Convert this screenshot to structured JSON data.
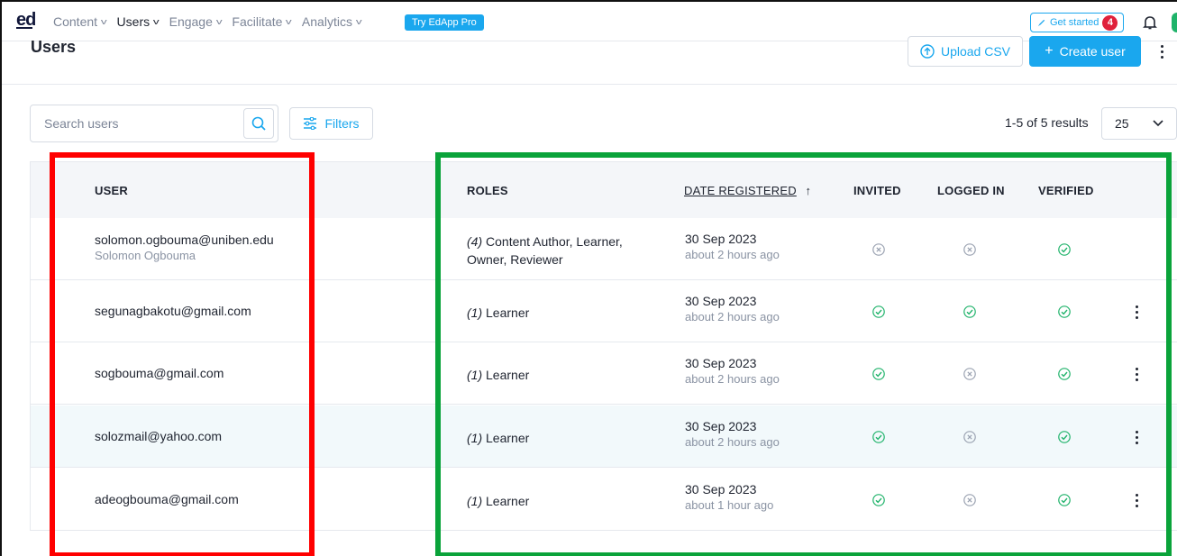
{
  "nav": {
    "logo": "ed",
    "items": [
      "Content",
      "Users",
      "Engage",
      "Facilitate",
      "Analytics"
    ],
    "active": "Users",
    "try_pro": "Try EdApp Pro",
    "get_started": "Get started",
    "get_started_count": "4"
  },
  "header": {
    "title": "Users",
    "upload_label": "Upload CSV",
    "create_label": "Create user"
  },
  "toolbar": {
    "search_placeholder": "Search users",
    "filters_label": "Filters",
    "results_text": "1-5 of 5 results",
    "page_size": "25"
  },
  "table": {
    "columns": {
      "user": "USER",
      "roles": "ROLES",
      "date": "DATE REGISTERED",
      "invited": "INVITED",
      "logged_in": "LOGGED IN",
      "verified": "VERIFIED"
    },
    "sort_indicator": "↑",
    "rows": [
      {
        "email": "solomon.ogbouma@uniben.edu",
        "name": "Solomon Ogbouma",
        "role_count": "(4)",
        "roles_line1": "Content Author, Learner,",
        "roles_line2": "Owner, Reviewer",
        "date": "30 Sep 2023",
        "relative": "about 2 hours ago",
        "invited": false,
        "logged_in": false,
        "verified": true,
        "has_menu": false
      },
      {
        "email": "segunagbakotu@gmail.com",
        "name": "",
        "role_count": "(1)",
        "roles_line1": "Learner",
        "roles_line2": "",
        "date": "30 Sep 2023",
        "relative": "about 2 hours ago",
        "invited": true,
        "logged_in": true,
        "verified": true,
        "has_menu": true
      },
      {
        "email": "sogbouma@gmail.com",
        "name": "",
        "role_count": "(1)",
        "roles_line1": "Learner",
        "roles_line2": "",
        "date": "30 Sep 2023",
        "relative": "about 2 hours ago",
        "invited": true,
        "logged_in": false,
        "verified": true,
        "has_menu": true
      },
      {
        "email": "solozmail@yahoo.com",
        "name": "",
        "role_count": "(1)",
        "roles_line1": "Learner",
        "roles_line2": "",
        "date": "30 Sep 2023",
        "relative": "about 2 hours ago",
        "invited": true,
        "logged_in": false,
        "verified": true,
        "has_menu": true
      },
      {
        "email": "adeogbouma@gmail.com",
        "name": "",
        "role_count": "(1)",
        "roles_line1": "Learner",
        "roles_line2": "",
        "date": "30 Sep 2023",
        "relative": "about 1 hour ago",
        "invited": true,
        "logged_in": false,
        "verified": true,
        "has_menu": true
      }
    ]
  },
  "colors": {
    "accent": "#1aa7ee",
    "status_yes": "#1fb36a",
    "status_no": "#9aa2b1",
    "annotation_red": "#ff0000",
    "annotation_green": "#0aa33a"
  }
}
